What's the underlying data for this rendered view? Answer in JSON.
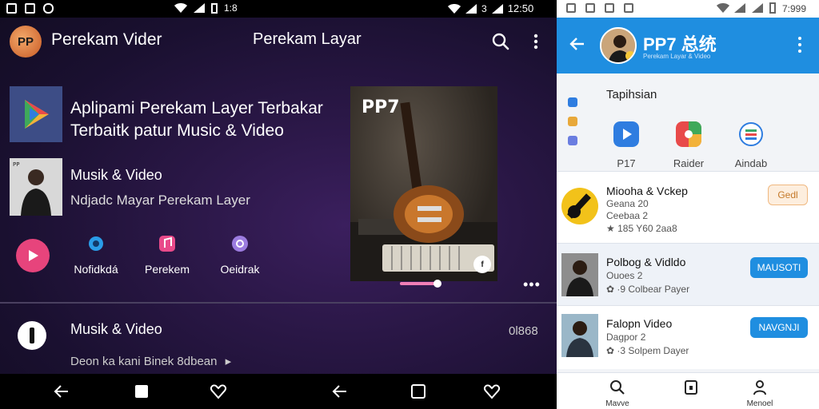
{
  "left": {
    "statusbar": {
      "time_mid": "1:8",
      "right_text": "3",
      "time": "12:50"
    },
    "appbar": {
      "logo_text": "PP",
      "title": "Perekam Vider",
      "center_title": "Perekam Layar"
    },
    "feature": {
      "title": "Aplipami Perekam Layer Terbakar Terbaitk patur Music & Video"
    },
    "music_item": {
      "title": "Musik & Video",
      "subtitle": "Ndjadc Mayar Perekam Layer"
    },
    "quick_actions": [
      {
        "label": "Nofidkdá",
        "icon": "gear-icon",
        "color": "#2a9de8"
      },
      {
        "label": "Perekem",
        "icon": "music-icon",
        "color": "#e84a8a"
      },
      {
        "label": "Oeidrak",
        "icon": "at-icon",
        "color": "#9c7ce0"
      }
    ],
    "album": {
      "label": "PP7",
      "badge": "f"
    },
    "progress": {
      "fraction": 0.9
    },
    "bottom_item": {
      "title": "Musik & Video",
      "subtitle": "Deon ka kani Binek 8dbean",
      "count": "0l868"
    },
    "colors": {
      "accent": "#e7447c",
      "play": "#e7447c"
    }
  },
  "right": {
    "statusbar": {
      "time": "7:999"
    },
    "header": {
      "title": "PP7 总统",
      "subtitle": "Perekam Layar & Video"
    },
    "section_title": "Tapihsian",
    "categories": [
      {
        "label": "P17",
        "icon": "play-icon",
        "color": "#2f7de0"
      },
      {
        "label": "Raider",
        "icon": "grid-icon",
        "color": "#e8a83a"
      },
      {
        "label": "Aindab",
        "icon": "list-icon",
        "color": "#3aa86a"
      }
    ],
    "items": [
      {
        "name": "Miooha & Vckep",
        "meta": "Geana 20",
        "meta2": "Ceebaa 2",
        "stats": "★ 185 Y60 2aa8",
        "button": "Gedl"
      },
      {
        "name": "Polbog & Vidldo",
        "meta": "Ouoes 2",
        "stats": "✿ ·9 Colbear Payer",
        "button": "MAUSOTI"
      },
      {
        "name": "Falopn Video",
        "meta": "Dagpor 2",
        "stats": "✿ ·3 Solpem Dayer",
        "button": "NAVGNJI"
      }
    ],
    "tabs": [
      {
        "label": "Mavve",
        "icon": "search-icon"
      },
      {
        "label": "",
        "icon": "tablet-icon"
      },
      {
        "label": "Menoel",
        "icon": "user-icon"
      }
    ],
    "colors": {
      "primary": "#1f8ee0"
    }
  }
}
